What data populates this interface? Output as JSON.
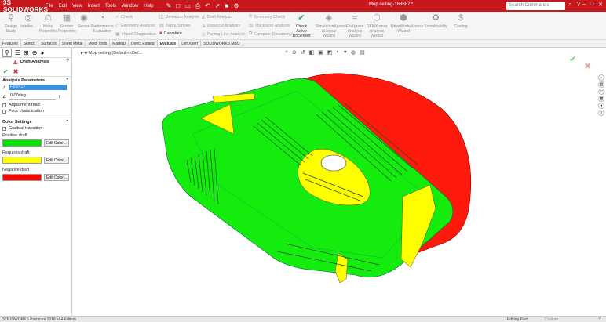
{
  "app": {
    "logo": "3S SOLIDWORKS",
    "document_title": "Mop ceiling-163687 *",
    "search_placeholder": "Search Commands"
  },
  "menu": [
    "File",
    "Edit",
    "View",
    "Insert",
    "Tools",
    "Window",
    "Help"
  ],
  "ribbon": {
    "design_study": "Design Study",
    "interference": "Interfer...",
    "mass_properties": "Mass Properties",
    "section_properties": "Section Properties",
    "sensor": "Sensor",
    "performance_evaluation": "Performance Evaluation",
    "check": "Check",
    "geometry_analysis": "Geometry Analysis",
    "import_diagnostics": "Import Diagnostics",
    "deviation_analysis": "Deviation Analysis",
    "zebra_stripes": "Zebra Stripes",
    "curvature": "Curvature",
    "draft_analysis": "Draft Analysis",
    "undercut_analysis": "Undercut Analysis",
    "parting_line_analysis": "Parting Line Analysis",
    "symmetry_check": "Symmetry Check",
    "thickness_analysis": "Thickness Analysis",
    "compare_documents": "Compare Documents",
    "check_active_document": "Check Active Document",
    "simxpress": "SimulationXpress Analysis Wizard",
    "floxpress": "FloXpress Analysis Wizard",
    "driveworks": "DFMXpress Analysis Wizard",
    "driveworksxpress": "DriveWorksXpress Wizard",
    "sustainability": "Sustainability",
    "costing": "Costing"
  },
  "tabs": [
    {
      "label": "Features",
      "active": false
    },
    {
      "label": "Sketch",
      "active": false
    },
    {
      "label": "Surfaces",
      "active": false
    },
    {
      "label": "Sheet Metal",
      "active": false
    },
    {
      "label": "Mold Tools",
      "active": false
    },
    {
      "label": "Markup",
      "active": false
    },
    {
      "label": "Direct Editing",
      "active": false
    },
    {
      "label": "Evaluate",
      "active": true
    },
    {
      "label": "DimXpert",
      "active": false
    },
    {
      "label": "SOLIDWORKS MBD",
      "active": false
    }
  ],
  "panel": {
    "title": "Draft Analysis",
    "analysis_parameters": "Analysis Parameters",
    "direction_value": "Face<1>",
    "draft_angle": "0.00deg",
    "adjustment_triad": "Adjustment triad",
    "face_classification": "Face classification",
    "color_settings": "Color Settings",
    "gradual_transition": "Gradual transition",
    "positive_draft": "Positive draft",
    "requires_draft": "Requires draft",
    "negative_draft": "Negative draft",
    "edit_color": "Edit Color...",
    "colors": {
      "positive": "#00e400",
      "requires": "#ffff00",
      "negative": "#ff0000"
    }
  },
  "viewport": {
    "tree_item": "Mop ceiling (Default<<Def..."
  },
  "status": {
    "left": "SOLIDWORKS Premium 2018 x64 Edition",
    "editing": "Editing Part",
    "units": "Custom"
  }
}
